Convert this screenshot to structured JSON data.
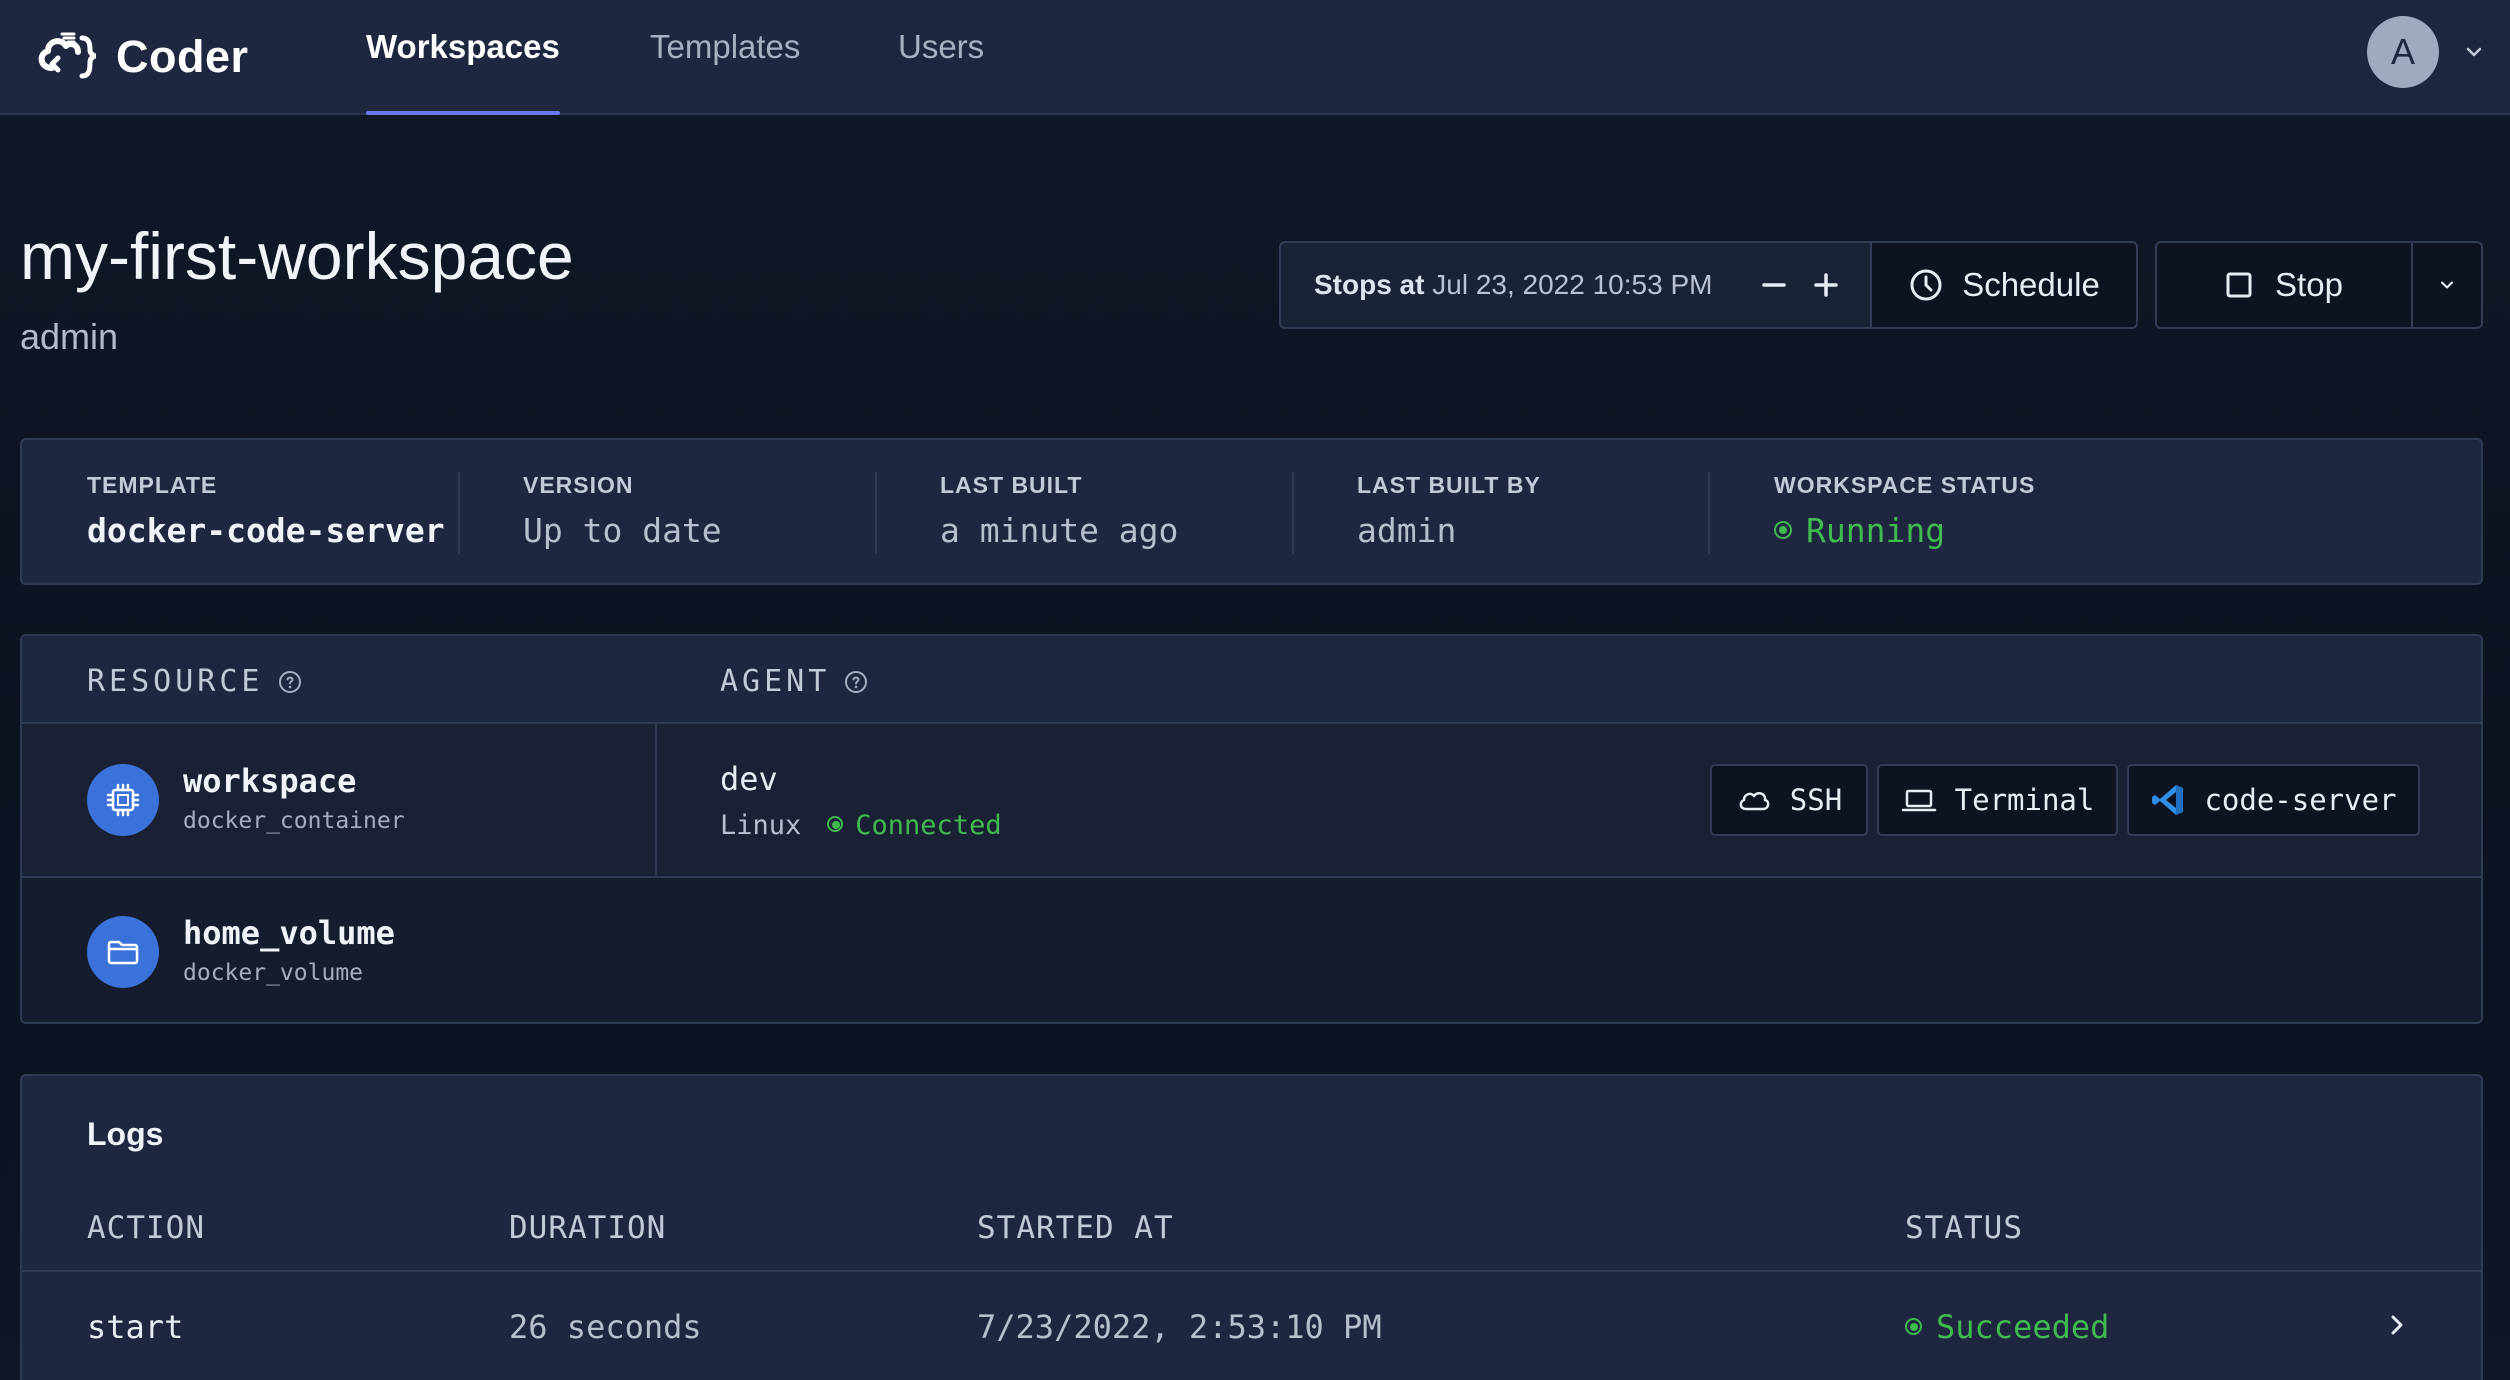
{
  "app": {
    "name": "Coder",
    "nav": [
      {
        "label": "Workspaces",
        "active": true
      },
      {
        "label": "Templates",
        "active": false
      },
      {
        "label": "Users",
        "active": false
      }
    ],
    "user_initial": "A"
  },
  "workspace": {
    "name": "my-first-workspace",
    "owner": "admin",
    "stops_label": "Stops at",
    "stops_time": "Jul 23, 2022 10:53 PM",
    "schedule_label": "Schedule",
    "stop_label": "Stop"
  },
  "stats": [
    {
      "label": "TEMPLATE",
      "value": "docker-code-server"
    },
    {
      "label": "VERSION",
      "value": "Up to date"
    },
    {
      "label": "LAST BUILT",
      "value": "a minute ago"
    },
    {
      "label": "LAST BUILT BY",
      "value": "admin"
    },
    {
      "label": "WORKSPACE STATUS",
      "value": "Running"
    }
  ],
  "resources": {
    "headers": {
      "resource": "RESOURCE",
      "agent": "AGENT"
    },
    "items": [
      {
        "name": "workspace",
        "type": "docker_container",
        "icon": "cpu-chip-icon",
        "agent": {
          "name": "dev",
          "os": "Linux",
          "status": "Connected",
          "actions": [
            {
              "label": "SSH",
              "icon": "cloud-icon"
            },
            {
              "label": "Terminal",
              "icon": "laptop-icon"
            },
            {
              "label": "code-server",
              "icon": "vscode-icon"
            }
          ]
        }
      },
      {
        "name": "home_volume",
        "type": "docker_volume",
        "icon": "folder-icon"
      }
    ]
  },
  "logs": {
    "title": "Logs",
    "columns": [
      "ACTION",
      "DURATION",
      "STARTED AT",
      "STATUS"
    ],
    "rows": [
      {
        "action": "start",
        "duration": "26 seconds",
        "started_at": "7/23/2022, 2:53:10 PM",
        "status": "Succeeded"
      }
    ]
  },
  "colors": {
    "accent": "#6b76f2",
    "success": "#3fb950",
    "resource_icon_bg": "#3b72d9",
    "navbar_bg": "#1f2740"
  }
}
